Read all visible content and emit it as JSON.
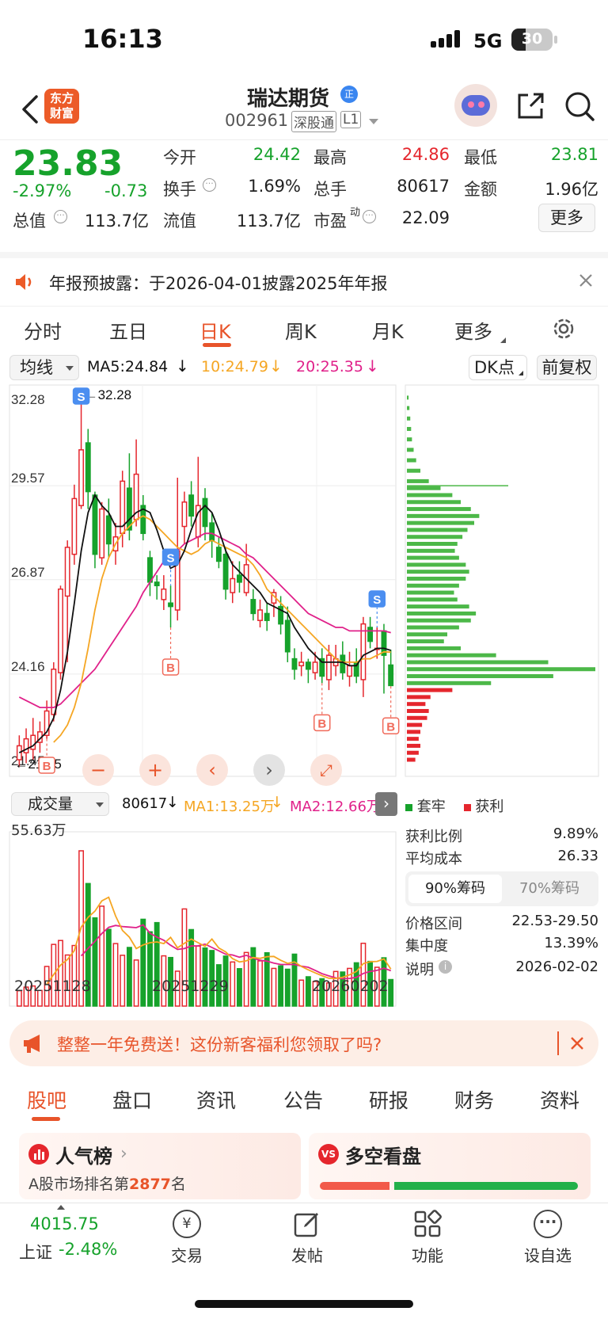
{
  "status": {
    "time": "16:13",
    "network": "5G",
    "battery": "30"
  },
  "header": {
    "logo_line1": "东方",
    "logo_line2": "财富",
    "title": "瑞达期货",
    "title_badge": "正",
    "code": "002961",
    "tag1": "深股通",
    "tag2": "L1"
  },
  "quote": {
    "price": "23.83",
    "change_pct": "-2.97%",
    "change": "-0.73",
    "open_label": "今开",
    "open": "24.42",
    "high_label": "最高",
    "high": "24.86",
    "low_label": "最低",
    "low": "23.81",
    "turnover_label": "换手",
    "turnover": "1.69%",
    "volume_label": "总手",
    "volume": "80617",
    "amount_label": "金额",
    "amount": "1.96亿",
    "mcap_label": "总值",
    "mcap": "113.7亿",
    "float_label": "流值",
    "float": "113.7亿",
    "pe_label": "市盈",
    "pe_sup": "动",
    "pe": "22.09",
    "more_label": "更多"
  },
  "notice": {
    "text": "年报预披露：于2026-04-01披露2025年年报"
  },
  "ktabs": [
    "分时",
    "五日",
    "日K",
    "周K",
    "月K",
    "更多"
  ],
  "ktabs_active": 2,
  "chart_bar": {
    "indicator": "均线",
    "ma5": "MA5:24.84",
    "ma10": "10:24.79",
    "ma20": "20:25.35",
    "dk": "DK点",
    "adjust": "前复权"
  },
  "chart_labels": {
    "max_marker": "32.28",
    "min_marker": "21.45"
  },
  "vol_bar": {
    "indicator": "成交量",
    "vol": "80617",
    "ma1": "MA1:13.25万",
    "ma2": "MA2:12.66万",
    "max": "55.63万"
  },
  "x_dates": [
    "20251128",
    "20251229",
    "20260202"
  ],
  "chip": {
    "legend_locked": "套牢",
    "legend_profit": "获利",
    "profit_ratio_label": "获利比例",
    "profit_ratio": "9.89%",
    "avg_cost_label": "平均成本",
    "avg_cost": "26.33",
    "tab1": "90%筹码",
    "tab2": "70%筹码",
    "range_label": "价格区间",
    "range": "22.53-29.50",
    "concentration_label": "集中度",
    "concentration": "13.39%",
    "note_label": "说明",
    "note_date": "2026-02-02"
  },
  "ad": {
    "text": "整整一年免费送！这份新客福利您领取了吗?"
  },
  "btabs": [
    "股吧",
    "盘口",
    "资讯",
    "公告",
    "研报",
    "财务",
    "资料"
  ],
  "btabs_active": 0,
  "cards": {
    "popular_title": "人气榜",
    "popular_sub_prefix": "A股市场排名第",
    "popular_rank": "2877",
    "popular_sub_suffix": "名",
    "vs_title": "多空看盘"
  },
  "bottom": {
    "index_value": "4015.75",
    "index_name": "上证",
    "index_change": "-2.48%",
    "trade": "交易",
    "post": "发帖",
    "func": "功能",
    "watch": "设自选"
  },
  "colors": {
    "up": "#e5262d",
    "down": "#16a22b",
    "accent": "#e8542a",
    "ma5": "#111111",
    "ma10": "#f5a623",
    "ma20": "#e0218a"
  },
  "chart_data": {
    "type": "candlestick",
    "y_ticks": [
      32.28,
      29.57,
      26.87,
      24.16,
      21.45
    ],
    "ylim": [
      21.45,
      32.28
    ],
    "candles": [
      {
        "o": 21.7,
        "c": 22.1,
        "h": 22.4,
        "l": 21.5
      },
      {
        "o": 21.9,
        "c": 22.3,
        "h": 22.6,
        "l": 21.6
      },
      {
        "o": 22.0,
        "c": 22.4,
        "h": 22.9,
        "l": 21.7
      },
      {
        "o": 22.2,
        "c": 22.5,
        "h": 22.8,
        "l": 21.9
      },
      {
        "o": 22.4,
        "c": 23.1,
        "h": 23.4,
        "l": 22.3
      },
      {
        "o": 23.0,
        "c": 24.3,
        "h": 24.5,
        "l": 22.8
      },
      {
        "o": 24.2,
        "c": 26.6,
        "h": 26.7,
        "l": 24.0
      },
      {
        "o": 26.4,
        "c": 27.8,
        "h": 28.0,
        "l": 24.5
      },
      {
        "o": 27.6,
        "c": 29.2,
        "h": 29.6,
        "l": 27.3
      },
      {
        "o": 29.0,
        "c": 30.6,
        "h": 32.28,
        "l": 28.9
      },
      {
        "o": 30.8,
        "c": 29.4,
        "h": 31.2,
        "l": 28.9
      },
      {
        "o": 29.3,
        "c": 27.6,
        "h": 29.4,
        "l": 27.2
      },
      {
        "o": 27.5,
        "c": 28.9,
        "h": 29.1,
        "l": 27.3
      },
      {
        "o": 28.7,
        "c": 27.9,
        "h": 29.2,
        "l": 27.5
      },
      {
        "o": 27.7,
        "c": 28.1,
        "h": 28.5,
        "l": 27.3
      },
      {
        "o": 28.2,
        "c": 29.7,
        "h": 30.0,
        "l": 27.8
      },
      {
        "o": 29.5,
        "c": 28.3,
        "h": 30.5,
        "l": 28.0
      },
      {
        "o": 28.6,
        "c": 29.9,
        "h": 30.9,
        "l": 28.4
      },
      {
        "o": 29.0,
        "c": 28.2,
        "h": 29.3,
        "l": 28.0
      },
      {
        "o": 27.5,
        "c": 26.8,
        "h": 27.7,
        "l": 26.4
      },
      {
        "o": 26.8,
        "c": 26.7,
        "h": 27.0,
        "l": 26.3
      },
      {
        "o": 26.3,
        "c": 26.6,
        "h": 27.0,
        "l": 26.0
      },
      {
        "o": 26.2,
        "c": 26.1,
        "h": 26.7,
        "l": 25.5
      },
      {
        "o": 26.0,
        "c": 27.7,
        "h": 29.8,
        "l": 25.7
      },
      {
        "o": 28.4,
        "c": 29.1,
        "h": 29.4,
        "l": 27.9
      },
      {
        "o": 29.3,
        "c": 28.7,
        "h": 29.7,
        "l": 28.4
      },
      {
        "o": 28.1,
        "c": 29.0,
        "h": 30.4,
        "l": 27.8
      },
      {
        "o": 29.2,
        "c": 28.4,
        "h": 29.5,
        "l": 28.0
      },
      {
        "o": 28.5,
        "c": 28.0,
        "h": 28.8,
        "l": 27.5
      },
      {
        "o": 27.8,
        "c": 27.4,
        "h": 28.1,
        "l": 27.2
      },
      {
        "o": 27.6,
        "c": 26.6,
        "h": 27.8,
        "l": 26.3
      },
      {
        "o": 26.5,
        "c": 26.9,
        "h": 27.4,
        "l": 26.2
      },
      {
        "o": 27.0,
        "c": 26.8,
        "h": 27.4,
        "l": 26.5
      },
      {
        "o": 26.5,
        "c": 27.3,
        "h": 27.9,
        "l": 26.4
      },
      {
        "o": 26.3,
        "c": 25.9,
        "h": 26.6,
        "l": 25.7
      },
      {
        "o": 25.7,
        "c": 26.0,
        "h": 26.3,
        "l": 25.5
      },
      {
        "o": 25.9,
        "c": 25.7,
        "h": 26.2,
        "l": 25.4
      },
      {
        "o": 26.2,
        "c": 26.5,
        "h": 26.6,
        "l": 25.8
      },
      {
        "o": 26.1,
        "c": 25.6,
        "h": 26.4,
        "l": 25.3
      },
      {
        "o": 25.7,
        "c": 24.8,
        "h": 26.1,
        "l": 24.5
      },
      {
        "o": 24.6,
        "c": 24.3,
        "h": 24.9,
        "l": 24.0
      },
      {
        "o": 24.4,
        "c": 24.5,
        "h": 24.8,
        "l": 24.1
      },
      {
        "o": 24.5,
        "c": 24.3,
        "h": 24.6,
        "l": 23.9
      },
      {
        "o": 24.2,
        "c": 24.5,
        "h": 24.8,
        "l": 24.0
      },
      {
        "o": 24.6,
        "c": 24.1,
        "h": 24.9,
        "l": 23.9
      },
      {
        "o": 24.0,
        "c": 24.7,
        "h": 25.0,
        "l": 23.7
      },
      {
        "o": 24.4,
        "c": 24.6,
        "h": 25.0,
        "l": 24.1
      },
      {
        "o": 24.7,
        "c": 24.2,
        "h": 25.1,
        "l": 24.0
      },
      {
        "o": 24.1,
        "c": 24.4,
        "h": 24.8,
        "l": 23.8
      },
      {
        "o": 24.5,
        "c": 24.1,
        "h": 24.9,
        "l": 23.9
      },
      {
        "o": 24.0,
        "c": 25.6,
        "h": 25.8,
        "l": 23.5
      },
      {
        "o": 25.5,
        "c": 25.1,
        "h": 25.8,
        "l": 24.9
      },
      {
        "o": 24.9,
        "c": 24.9,
        "h": 25.5,
        "l": 24.6
      },
      {
        "o": 25.4,
        "c": 24.7,
        "h": 25.6,
        "l": 23.6
      },
      {
        "o": 24.42,
        "c": 23.83,
        "h": 24.86,
        "l": 23.81
      }
    ],
    "ma5": [
      21.9,
      22.0,
      22.1,
      22.3,
      22.5,
      22.9,
      23.7,
      24.8,
      26.2,
      27.7,
      28.8,
      29.3,
      29.0,
      28.8,
      28.4,
      28.4,
      28.6,
      28.8,
      28.9,
      28.8,
      28.3,
      27.7,
      27.2,
      27.3,
      27.7,
      28.3,
      28.8,
      29.0,
      28.8,
      28.3,
      27.7,
      27.3,
      27.1,
      26.9,
      26.7,
      26.5,
      26.2,
      26.1,
      26.0,
      25.9,
      25.5,
      25.2,
      24.9,
      24.7,
      24.5,
      24.5,
      24.5,
      24.5,
      24.4,
      24.4,
      24.7,
      24.8,
      24.9,
      24.9,
      24.84
    ],
    "ma10": [
      null,
      null,
      null,
      null,
      null,
      22.2,
      22.4,
      22.7,
      23.2,
      23.9,
      24.9,
      26.0,
      26.9,
      27.5,
      27.9,
      28.2,
      28.4,
      28.6,
      28.7,
      28.6,
      28.4,
      28.2,
      28.0,
      27.8,
      27.7,
      27.6,
      27.7,
      27.9,
      28.0,
      27.9,
      27.8,
      27.7,
      27.6,
      27.5,
      27.3,
      27.0,
      26.6,
      26.4,
      26.2,
      26.0,
      25.8,
      25.6,
      25.4,
      25.2,
      25.0,
      24.8,
      24.6,
      24.5,
      24.5,
      24.5,
      24.6,
      24.6,
      24.7,
      24.8,
      24.79
    ],
    "ma20": [
      23.5,
      23.4,
      23.3,
      23.2,
      23.2,
      23.2,
      23.3,
      23.5,
      23.7,
      23.9,
      24.1,
      24.3,
      24.6,
      24.9,
      25.2,
      25.5,
      25.8,
      26.1,
      26.5,
      26.8,
      27.1,
      27.4,
      27.6,
      27.7,
      27.9,
      28.0,
      28.1,
      28.2,
      28.2,
      28.1,
      28.0,
      27.9,
      27.8,
      27.6,
      27.5,
      27.3,
      27.1,
      26.9,
      26.7,
      26.5,
      26.3,
      26.1,
      25.9,
      25.8,
      25.7,
      25.6,
      25.5,
      25.5,
      25.4,
      25.4,
      25.4,
      25.4,
      25.4,
      25.4,
      25.35
    ],
    "markers": [
      {
        "i": 4,
        "type": "B",
        "side": "below_low"
      },
      {
        "i": 9,
        "type": "S",
        "side": "above_high"
      },
      {
        "i": 22,
        "type": "S",
        "side": "above_high"
      },
      {
        "i": 22,
        "type": "B",
        "side": "below_low"
      },
      {
        "i": 44,
        "type": "B",
        "side": "below_low"
      },
      {
        "i": 52,
        "type": "S",
        "side": "above_high"
      },
      {
        "i": 54,
        "type": "B",
        "side": "below_low"
      }
    ],
    "volumes": [
      5.5,
      6.8,
      7.2,
      5.6,
      14.2,
      22.1,
      23.5,
      18.3,
      21.7,
      55.63,
      43.9,
      31.6,
      35.8,
      27.5,
      22.4,
      18.2,
      21.0,
      16.5,
      31.1,
      26.6,
      29.9,
      18.0,
      17.4,
      12.5,
      34.8,
      27.4,
      21.5,
      20.8,
      19.9,
      14.8,
      17.9,
      15.8,
      13.4,
      19.2,
      20.9,
      16.2,
      19.1,
      13.5,
      14.4,
      13.2,
      18.6,
      9.3,
      10.5,
      8.8,
      9.8,
      8.3,
      12.4,
      12.2,
      13.5,
      15.5,
      22.5,
      16.0,
      13.9,
      17.3,
      9.5
    ],
    "vol_ma1": [
      null,
      null,
      null,
      null,
      7.9,
      11.3,
      14.7,
      16.7,
      19.9,
      28.3,
      31.8,
      34.0,
      37.7,
      39.0,
      32.3,
      27.1,
      24.7,
      20.6,
      21.9,
      22.7,
      23.0,
      22.4,
      24.6,
      20.9,
      22.5,
      24.0,
      22.7,
      21.4,
      24.0,
      20.8,
      19.4,
      17.0,
      15.8,
      16.2,
      17.4,
      17.1,
      17.7,
      17.8,
      16.4,
      15.3,
      15.8,
      14.2,
      13.0,
      11.9,
      10.9,
      10.0,
      9.9,
      10.3,
      11.2,
      12.4,
      15.2,
      15.9,
      16.0,
      16.9,
      13.25
    ],
    "vol_ma2": [
      null,
      null,
      null,
      null,
      null,
      null,
      null,
      null,
      null,
      18.0,
      20.7,
      23.2,
      26.0,
      28.2,
      28.9,
      28.5,
      28.3,
      28.1,
      29.1,
      26.1,
      24.7,
      23.6,
      21.8,
      20.3,
      20.6,
      21.5,
      21.6,
      22.2,
      21.0,
      19.8,
      18.6,
      18.3,
      17.5,
      18.2,
      17.2,
      16.4,
      16.1,
      15.4,
      14.9,
      14.9,
      14.9,
      14.3,
      13.9,
      12.8,
      11.6,
      10.8,
      10.1,
      9.8,
      9.9,
      10.3,
      11.7,
      12.4,
      12.8,
      13.6,
      12.66
    ],
    "chip_hist": [
      {
        "p": 32.1,
        "w": 2
      },
      {
        "p": 31.8,
        "w": 3
      },
      {
        "p": 31.5,
        "w": 4
      },
      {
        "p": 31.2,
        "w": 5
      },
      {
        "p": 30.9,
        "w": 6
      },
      {
        "p": 30.6,
        "w": 8
      },
      {
        "p": 30.3,
        "w": 11
      },
      {
        "p": 30.0,
        "w": 16
      },
      {
        "p": 29.7,
        "w": 26
      },
      {
        "p": 29.5,
        "w": 40
      },
      {
        "p": 29.3,
        "w": 54
      },
      {
        "p": 29.1,
        "w": 64
      },
      {
        "p": 28.9,
        "w": 76
      },
      {
        "p": 28.7,
        "w": 86
      },
      {
        "p": 28.5,
        "w": 80
      },
      {
        "p": 28.3,
        "w": 72
      },
      {
        "p": 28.1,
        "w": 66
      },
      {
        "p": 27.9,
        "w": 60
      },
      {
        "p": 27.7,
        "w": 57
      },
      {
        "p": 27.5,
        "w": 62
      },
      {
        "p": 27.3,
        "w": 70
      },
      {
        "p": 27.1,
        "w": 74
      },
      {
        "p": 26.9,
        "w": 70
      },
      {
        "p": 26.7,
        "w": 62
      },
      {
        "p": 26.5,
        "w": 56
      },
      {
        "p": 26.3,
        "w": 60
      },
      {
        "p": 26.1,
        "w": 74
      },
      {
        "p": 25.9,
        "w": 82
      },
      {
        "p": 25.7,
        "w": 76
      },
      {
        "p": 25.5,
        "w": 62
      },
      {
        "p": 25.3,
        "w": 48
      },
      {
        "p": 25.1,
        "w": 44
      },
      {
        "p": 24.9,
        "w": 64
      },
      {
        "p": 24.7,
        "w": 106
      },
      {
        "p": 24.5,
        "w": 168
      },
      {
        "p": 24.3,
        "w": 224
      },
      {
        "p": 24.1,
        "w": 174
      },
      {
        "p": 23.9,
        "w": 100
      },
      {
        "p": 23.7,
        "w": 54
      },
      {
        "p": 23.5,
        "w": 28
      },
      {
        "p": 23.3,
        "w": 22
      },
      {
        "p": 23.1,
        "w": 26
      },
      {
        "p": 22.9,
        "w": 24
      },
      {
        "p": 22.7,
        "w": 18
      },
      {
        "p": 22.5,
        "w": 16
      },
      {
        "p": 22.3,
        "w": 14
      },
      {
        "p": 22.1,
        "w": 16
      },
      {
        "p": 21.9,
        "w": 14
      },
      {
        "p": 21.7,
        "w": 10
      }
    ]
  }
}
